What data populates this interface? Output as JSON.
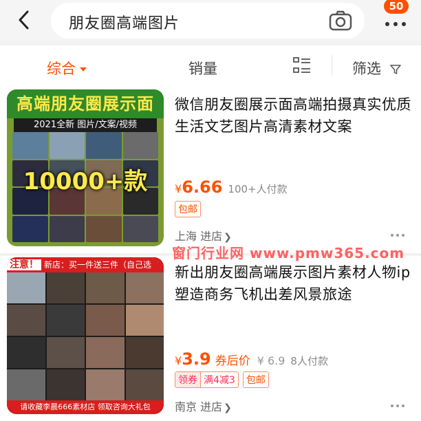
{
  "search": {
    "query": "朋友圈高端图片",
    "cart_count": "50"
  },
  "sort": {
    "comprehensive": "综合",
    "sales": "销量",
    "filter": "筛选"
  },
  "products": [
    {
      "title": "微信朋友圈展示面高端拍摄真实优质生活文艺图片高清素材文案",
      "currency": "¥",
      "price": "6.66",
      "paid": "100+人付款",
      "tags": [
        "包邮"
      ],
      "location": "上海",
      "store_link": "进店",
      "thumb": {
        "heading": "高端朋友圈展示面",
        "sub": "2021全新 图片/文案/视频",
        "big": "10000+款"
      }
    },
    {
      "title": "新出朋友圈高端展示图片素材人物ip塑造商务飞机出差风景旅途",
      "currency": "¥",
      "price": "3.9",
      "price_label": "券后价",
      "original_price": "¥ 6.9",
      "paid": "8人付款",
      "coupon_tag": {
        "label": "领券",
        "value": "满4减3"
      },
      "tags": [
        "包邮"
      ],
      "location": "南京",
      "store_link": "进店",
      "thumb": {
        "top_notice_label": "注意！",
        "top_notice": "新店：买一件送三件（自己选",
        "bottom": "请收藏李晨666素材店  领取咨询大礼包"
      }
    }
  ],
  "watermark": "窗门行业网 www.pmw365.com",
  "colors": {
    "accent": "#ff5000",
    "badge": "#ff5000"
  },
  "icons": [
    "back-arrow-icon",
    "camera-icon",
    "more-dots-icon",
    "caret-down-icon",
    "layout-grid-icon",
    "filter-funnel-icon",
    "chevron-right-icon"
  ]
}
